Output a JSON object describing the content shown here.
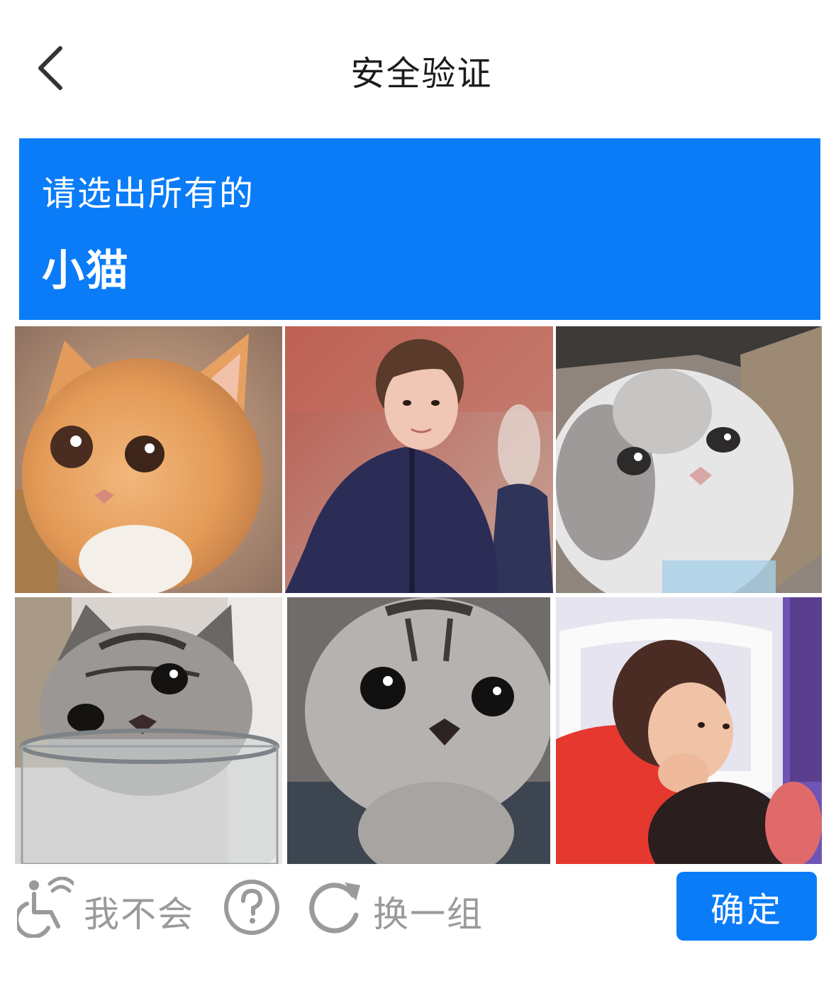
{
  "header": {
    "title": "安全验证",
    "back_icon": "chevron-left-icon"
  },
  "prompt": {
    "instruction": "请选出所有的",
    "target": "小猫",
    "background_color": "#0a7cf8"
  },
  "grid": {
    "tiles": [
      {
        "subject": "orange kitten"
      },
      {
        "subject": "person in navy jacket"
      },
      {
        "subject": "white and grey kitten"
      },
      {
        "subject": "tabby kitten in glass jar"
      },
      {
        "subject": "grey tabby kitten"
      },
      {
        "subject": "person in red shirt"
      }
    ]
  },
  "footer": {
    "accessibility_label": "我不会",
    "accessibility_icon": "accessibility-icon",
    "help_icon": "question-circle-icon",
    "refresh_label": "换一组",
    "refresh_icon": "refresh-icon",
    "confirm_label": "确定",
    "accent_color": "#0a7cf8",
    "muted_color": "#9a9a9a"
  }
}
